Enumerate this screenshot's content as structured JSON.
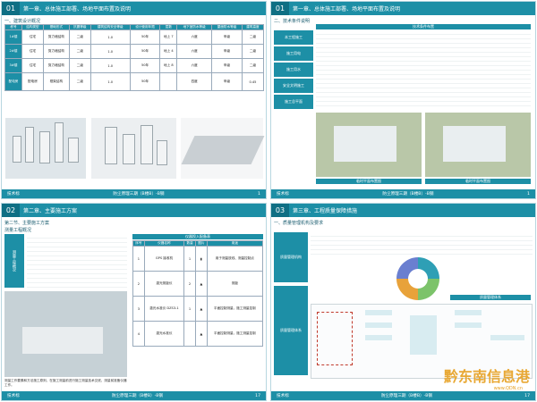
{
  "panels": [
    {
      "num": "01",
      "title": "第一章、总体施工部署、场地平面布置及说明",
      "subtitle": "一、建筑设计概况",
      "footer_left": "技术标",
      "footer_center": "防尘原理三期（B楼B）-B钢",
      "footer_right": "1",
      "table_headers": [
        "栋号",
        "结构类型",
        "基础形式",
        "抗震等级",
        "建筑结构安全等级",
        "设计使用年限",
        "层数",
        "地下室防水等级",
        "屋面防水等级",
        "建筑高度"
      ],
      "rows": [
        {
          "side": "1#楼",
          "v": [
            "住宅",
            "剪力墙结构",
            "二级",
            "1.0",
            "50年",
            "地上 7",
            "六度",
            "甲级",
            "二级"
          ]
        },
        {
          "side": "2#楼",
          "v": [
            "住宅",
            "剪力墙结构",
            "二级",
            "1.0",
            "50年",
            "地上 4",
            "六度",
            "甲级",
            "二级"
          ]
        },
        {
          "side": "3#楼",
          "v": [
            "住宅",
            "剪力墙结构",
            "二级",
            "1.0",
            "50年",
            "地上 8",
            "六度",
            "甲级",
            "二级"
          ]
        }
      ],
      "second_side": "配电房",
      "second_row": [
        "配电房",
        "框架结构",
        "二级",
        "1.0",
        "50年",
        "",
        "四度",
        "甲级",
        "0.45"
      ]
    },
    {
      "num": "01",
      "title": "第一章、总体施工部署、场地平面布置及说明",
      "subtitle": "二、技术条件说明",
      "box_title": "技术条件布置",
      "labels": [
        "本工程施工",
        "施工用电",
        "施工用水",
        "安全文明施工",
        "施工总平面"
      ],
      "map1": "临时平面布置图",
      "map2": "临时平面布置图",
      "footer_left": "技术标",
      "footer_center": "防尘原理三期（B楼B）-B钢",
      "footer_right": "1"
    },
    {
      "num": "02",
      "title": "第二章、主要施工方案",
      "subtitle": "第二节、主要施工方案",
      "section": "测量工程概况",
      "left_label": "测量工程概况",
      "table_title": "仪器投入配备表",
      "instr_headers": [
        "序号",
        "仪器名称",
        "数量",
        "图片",
        "用途"
      ],
      "instruments": [
        {
          "no": "1",
          "name": "GPS 接收机",
          "qty": "1",
          "use": "用于测量放线、测量控制点"
        },
        {
          "no": "2",
          "name": "激光测距仪",
          "qty": "2",
          "use": "测距"
        },
        {
          "no": "3",
          "name": "激光水准仪 DZS3-1",
          "qty": "1",
          "use": "平面控制测量，施工测量控制"
        },
        {
          "no": "4",
          "name": "激光水准仪",
          "qty": "",
          "use": "平面控制测量，施工测量控制"
        }
      ],
      "caption": "测量工作要素和方法施工原则，在施工测量前进行施工测量技术交底，测量前准备仪器工作。",
      "footer_left": "技术标",
      "footer_center": "防尘原理三期（B楼B）-B钢",
      "footer_right": "17"
    },
    {
      "num": "03",
      "title": "第三章、工程质量保障措施",
      "subtitle": "一、质量管理机构及要求",
      "section": "质量管理机构",
      "left_labels": [
        "质量管理机构",
        "质量管理体系"
      ],
      "org_title": "质量管理体系",
      "footer_left": "技术标",
      "footer_center": "防尘原理三期（B楼B）-B钢",
      "footer_right": "17"
    }
  ],
  "watermark": "黔东南信息港",
  "watermark_url": "www.QDN.cn",
  "colors": {
    "accent": "#1d8fa6",
    "dark": "#0f6f84",
    "watermark": "#e7a020"
  }
}
